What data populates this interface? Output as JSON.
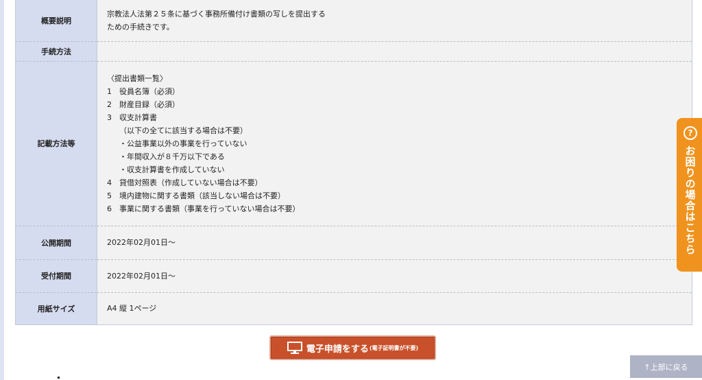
{
  "rows": [
    {
      "label": "概要説明",
      "lines": [
        "宗教法人法第２５条に基づく事務所備付け書類の写しを提出する",
        "ための手続きです。"
      ]
    },
    {
      "label": "手続方法",
      "lines": []
    },
    {
      "label": "記載方法等",
      "lines": [
        "〈提出書類一覧〉",
        "1　役員名簿（必須）",
        "2　財産目録（必須）",
        "3　収支計算書",
        "（以下の全てに該当する場合は不要）",
        "・公益事業以外の事業を行っていない",
        "・年間収入が８千万以下である",
        "・収支計算書を作成していない",
        "4　貸借対照表（作成していない場合は不要）",
        "5　境内建物に関する書類（該当しない場合は不要）",
        "6　事業に関する書類（事業を行っていない場合は不要）"
      ]
    },
    {
      "label": "公開期間",
      "lines": [
        "2022年02月01日～"
      ]
    },
    {
      "label": "受付期間",
      "lines": [
        "2022年02月01日～"
      ]
    },
    {
      "label": "用紙サイズ",
      "lines": [
        "A4 縦 1ページ"
      ]
    }
  ],
  "apply_button": {
    "main": "電子申請をする",
    "sub": "(電子証明書が不要)",
    "icon": "monitor-icon"
  },
  "help_tab": {
    "icon_glyph": "?",
    "label": "お困りの場合はこちら",
    "icon": "question-circle-icon"
  },
  "to_top": {
    "label": "↑上部に戻る"
  },
  "colors": {
    "header_bg": "#d6dcf0",
    "cell_bg": "#f2f2f2",
    "button_bg": "#c8512b",
    "help_bg": "#f0931e",
    "to_top_bg": "#aeb4c6"
  }
}
